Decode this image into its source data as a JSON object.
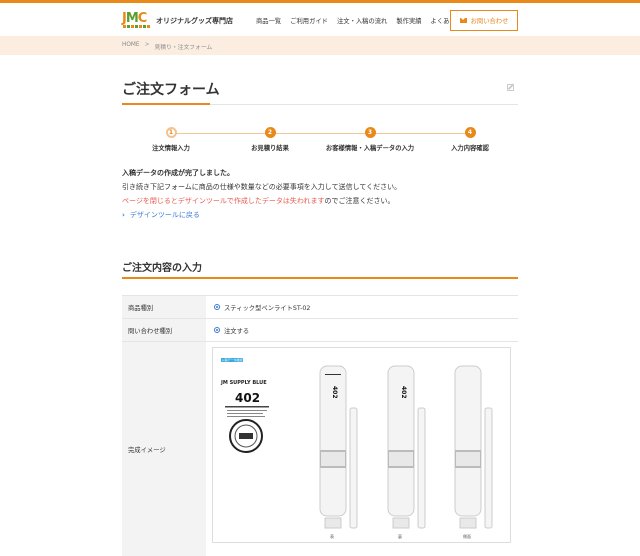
{
  "header": {
    "logo_text_a": "J",
    "logo_text_b": "M",
    "logo_text_c": "C",
    "site_name": "オリジナルグッズ専門店",
    "nav": [
      "商品一覧",
      "ご利用ガイド",
      "注文・入稿の流れ",
      "製作実績",
      "よくある質問"
    ],
    "contact_label": "お問い合わせ"
  },
  "breadcrumb": {
    "home": "HOME",
    "sep": ">",
    "current": "見積り・注文フォーム"
  },
  "page": {
    "title": "ご注文フォーム"
  },
  "steps": [
    {
      "num": "1",
      "label": "注文情報入力"
    },
    {
      "num": "2",
      "label": "お見積り結果"
    },
    {
      "num": "3",
      "label": "お客様情報・入稿データの入力"
    },
    {
      "num": "4",
      "label": "入力内容確認"
    }
  ],
  "messages": {
    "line1": "入稿データの作成が完了しました。",
    "line2": "引き続き下記フォームに商品の仕様や数量などの必要事項を入力して送信してください。",
    "line3_warn": "ページを閉じるとデザインツールで作成したデータは失われます",
    "line3_rest": "のでご注意ください。",
    "back_link": "デザインツールに戻る"
  },
  "section": {
    "title": "ご注文内容の入力"
  },
  "form": {
    "rows": [
      {
        "label": "商品種別",
        "value": "スティック型ペンライトST-02"
      },
      {
        "label": "問い合わせ種別",
        "value": "注文する"
      },
      {
        "label": "完成イメージ",
        "value": ""
      }
    ]
  },
  "preview": {
    "tag": "入稿データ確認",
    "card_brand": "JM SUPPLY BLUE",
    "card_number": "402",
    "stick_labels": [
      "表",
      "裏",
      "側面"
    ]
  },
  "colors": {
    "accent": "#e8891a",
    "breadcrumb_bg": "#fbeee1",
    "link": "#3a7bd5",
    "warn": "#e85a4f"
  }
}
